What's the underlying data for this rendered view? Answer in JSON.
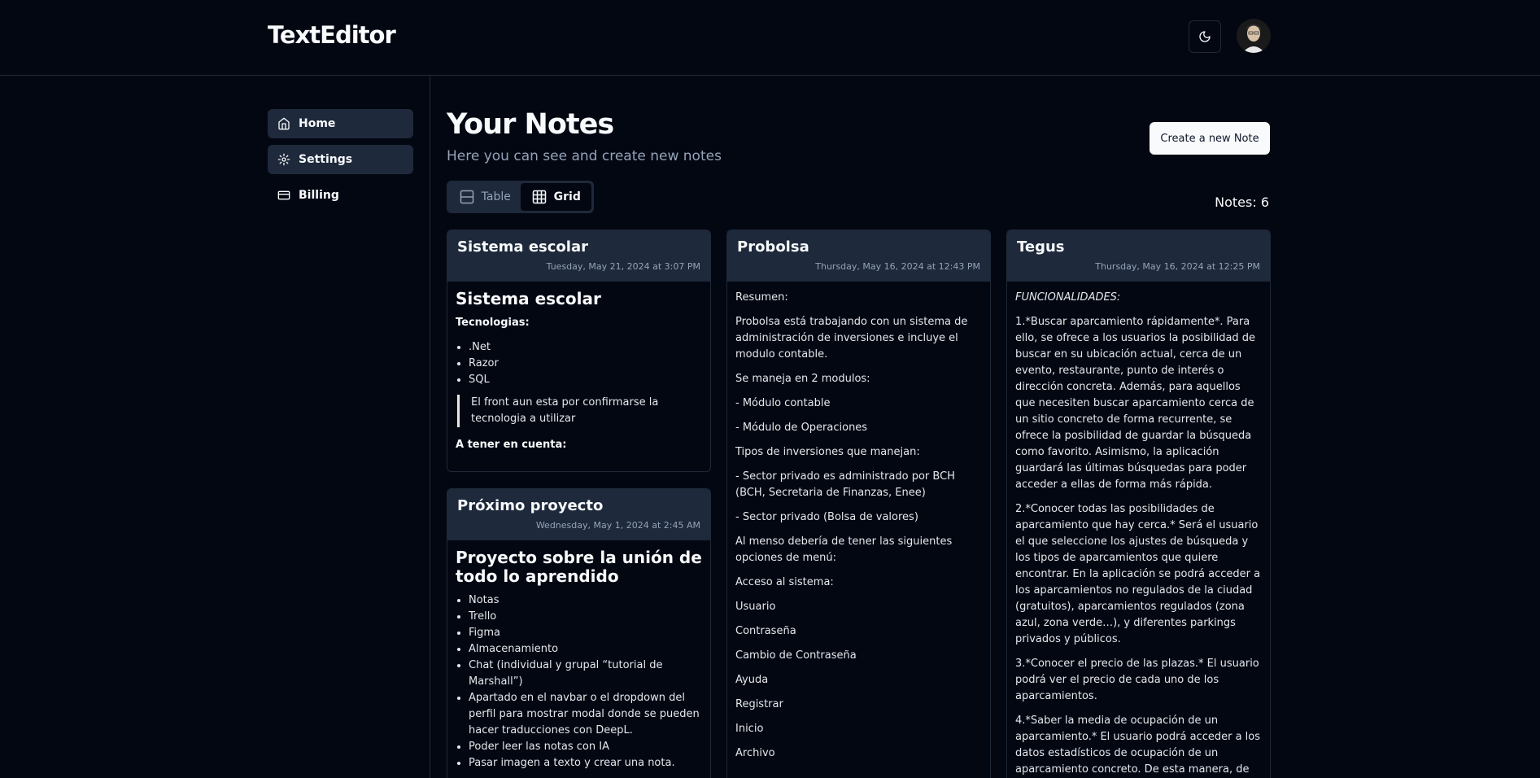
{
  "app": {
    "brand": "TextEditor",
    "theme_icon": "moon-icon"
  },
  "sidebar": {
    "items": [
      {
        "label": "Home",
        "icon": "home-icon"
      },
      {
        "label": "Settings",
        "icon": "gear-icon"
      },
      {
        "label": "Billing",
        "icon": "credit-card-icon"
      }
    ]
  },
  "header": {
    "title": "Your Notes",
    "subtitle": "Here you can see and create new notes",
    "create_label": "Create a new Note"
  },
  "view_toggle": {
    "table_label": "Table",
    "grid_label": "Grid",
    "selected": "Grid"
  },
  "notes_count": "Notes: 6",
  "notes": [
    {
      "title": "Sistema escolar",
      "date": "Tuesday, May 21, 2024 at 3:07 PM",
      "heading": "Sistema escolar",
      "tech_label": "Tecnologias:",
      "tech": [
        ".Net",
        "Razor",
        "SQL"
      ],
      "quote": "El front aun esta por confirmarse la tecnologia a utilizar",
      "footer_label": "A tener en cuenta:"
    },
    {
      "title": "Próximo proyecto",
      "date": "Wednesday, May 1, 2024 at 2:45 AM",
      "heading": "Proyecto sobre la unión de todo lo aprendido",
      "items": [
        "Notas",
        "Trello",
        "Figma",
        "Almacenamiento",
        "Chat (individual y grupal “tutorial de Marshall”)",
        "Apartado en el navbar o el dropdown del perfil para mostrar modal donde se pueden hacer traducciones con DeepL.",
        "Poder leer las notas con IA",
        "Pasar imagen a texto y crear una nota."
      ]
    },
    {
      "title": "Probolsa",
      "date": "Thursday, May 16, 2024 at 12:43 PM",
      "paragraphs": [
        "Resumen:",
        "Probolsa está trabajando con un sistema de administración de inversiones e incluye el modulo contable.",
        "Se maneja en 2 modulos:",
        "- Módulo contable",
        "- Módulo de Operaciones",
        "Tipos de inversiones que manejan:",
        "- Sector privado es administrado por BCH (BCH, Secretaria de Finanzas, Enee)",
        "- Sector privado (Bolsa de valores)",
        "Al menso debería de tener las siguientes opciones de menú:",
        "Acceso al sistema:",
        "Usuario",
        "Contraseña",
        "Cambio de Contraseña",
        "Ayuda",
        "Registrar",
        "Inicio",
        "Archivo"
      ]
    },
    {
      "title": "Tegus",
      "date": "Thursday, May 16, 2024 at 12:25 PM",
      "heading_italic": "FUNCIONALIDADES:",
      "paragraphs": [
        "1.*Buscar aparcamiento rápidamente*. Para ello, se ofrece a los usuarios la posibilidad de buscar en su ubicación actual, cerca de un evento, restaurante, punto de interés o dirección concreta. Además, para aquellos que necesiten buscar aparcamiento cerca de un sitio concreto de forma recurrente, se ofrece la posibilidad de guardar la búsqueda como favorito. Asimismo, la aplicación guardará las últimas búsquedas para poder acceder a ellas de forma más rápida.",
        "2.*Conocer todas las posibilidades de aparcamiento que hay cerca.* Será el usuario el que seleccione los ajustes de búsqueda y los tipos de aparcamientos que quiere encontrar. En la aplicación se podrá acceder a los aparcamientos no regulados de la ciudad (gratuitos), aparcamientos regulados (zona azul, zona verde…), y diferentes parkings privados y públicos.",
        "3.*Conocer el precio de las plazas.* El usuario podrá ver el precio de cada uno de los aparcamientos.",
        "4.*Saber la media de ocupación de un aparcamiento.* El usuario podrá acceder a los datos estadísticos de ocupación de un aparcamiento concreto. De esta manera, de"
      ]
    }
  ]
}
